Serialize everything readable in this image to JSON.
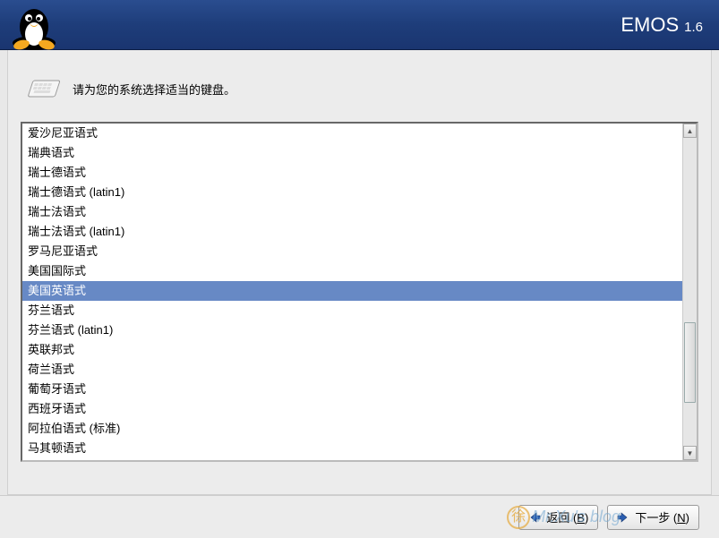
{
  "header": {
    "brand": "EMOS",
    "version": "1.6"
  },
  "instruction": "请为您的系统选择适当的键盘。",
  "keyboard_list": {
    "selected_index": 8,
    "items": [
      "爱沙尼亚语式",
      "瑞典语式",
      "瑞士德语式",
      "瑞士德语式 (latin1)",
      "瑞士法语式",
      "瑞士法语式 (latin1)",
      "罗马尼亚语式",
      "美国国际式",
      "美国英语式",
      "芬兰语式",
      "芬兰语式 (latin1)",
      "英联邦式",
      "荷兰语式",
      "葡萄牙语式",
      "西班牙语式",
      "阿拉伯语式 (标准)",
      "马其顿语式"
    ]
  },
  "buttons": {
    "back_prefix": "返回 (",
    "back_key": "B",
    "back_suffix": ")",
    "next_prefix": "下一步 (",
    "next_key": "N",
    "next_suffix": ")"
  },
  "watermark": "Mr.Xu's blog"
}
